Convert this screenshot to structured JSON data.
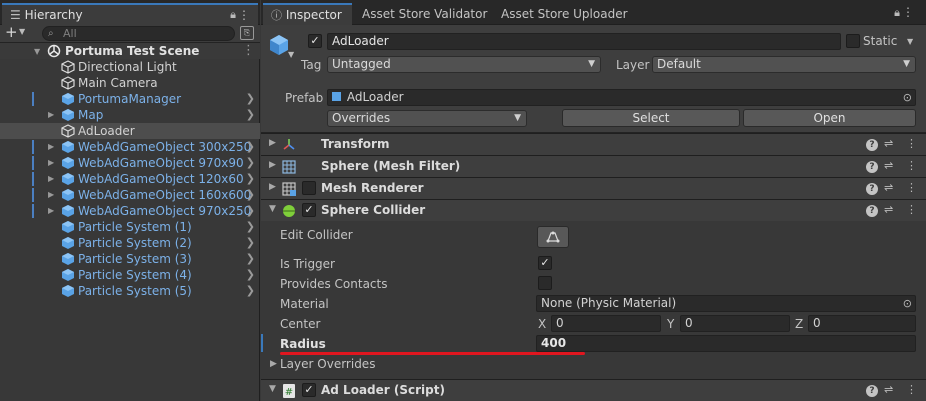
{
  "hierarchy": {
    "tab": "Hierarchy",
    "search_placeholder": "All",
    "scene": "Portuma Test Scene",
    "items": [
      {
        "label": "Directional Light",
        "color": "#d2d2d2"
      },
      {
        "label": "Main Camera",
        "color": "#d2d2d2"
      },
      {
        "label": "PortumaManager",
        "color": "#7cb1e8"
      },
      {
        "label": "Map",
        "color": "#7cb1e8"
      },
      {
        "label": "AdLoader",
        "color": "#d2d2d2"
      },
      {
        "label": "WebAdGameObject 300x250",
        "color": "#7cb1e8"
      },
      {
        "label": "WebAdGameObject 970x90",
        "color": "#7cb1e8"
      },
      {
        "label": "WebAdGameObject 120x60",
        "color": "#7cb1e8"
      },
      {
        "label": "WebAdGameObject 160x600",
        "color": "#7cb1e8"
      },
      {
        "label": "WebAdGameObject 970x250",
        "color": "#7cb1e8"
      },
      {
        "label": "Particle System (1)",
        "color": "#7cb1e8"
      },
      {
        "label": "Particle System (2)",
        "color": "#7cb1e8"
      },
      {
        "label": "Particle System (3)",
        "color": "#7cb1e8"
      },
      {
        "label": "Particle System (4)",
        "color": "#7cb1e8"
      },
      {
        "label": "Particle System (5)",
        "color": "#7cb1e8"
      }
    ]
  },
  "inspector": {
    "tabs": [
      "Inspector",
      "Asset Store Validator",
      "Asset Store Uploader"
    ],
    "object_name": "AdLoader",
    "static_label": "Static",
    "tag_label": "Tag",
    "tag_value": "Untagged",
    "layer_label": "Layer",
    "layer_value": "Default",
    "prefab_label": "Prefab",
    "prefab_value": "AdLoader",
    "overrides_value": "Overrides",
    "select_label": "Select",
    "open_label": "Open",
    "components": {
      "transform": "Transform",
      "mesh_filter": "Sphere (Mesh Filter)",
      "mesh_renderer": "Mesh Renderer",
      "sphere_collider": "Sphere Collider",
      "ad_loader": "Ad Loader (Script)"
    },
    "collider": {
      "edit_collider": "Edit Collider",
      "is_trigger": "Is Trigger",
      "provides_contacts": "Provides Contacts",
      "material_label": "Material",
      "material_value": "None (Physic Material)",
      "center_label": "Center",
      "x_label": "X",
      "x_value": "0",
      "y_label": "Y",
      "y_value": "0",
      "z_label": "Z",
      "z_value": "0",
      "radius_label": "Radius",
      "radius_value": "400",
      "layer_overrides": "Layer Overrides"
    }
  },
  "colors": {
    "accent": "#3a79bb",
    "prefab_blue": "#7cb1e8",
    "highlight": "#e0161f"
  }
}
